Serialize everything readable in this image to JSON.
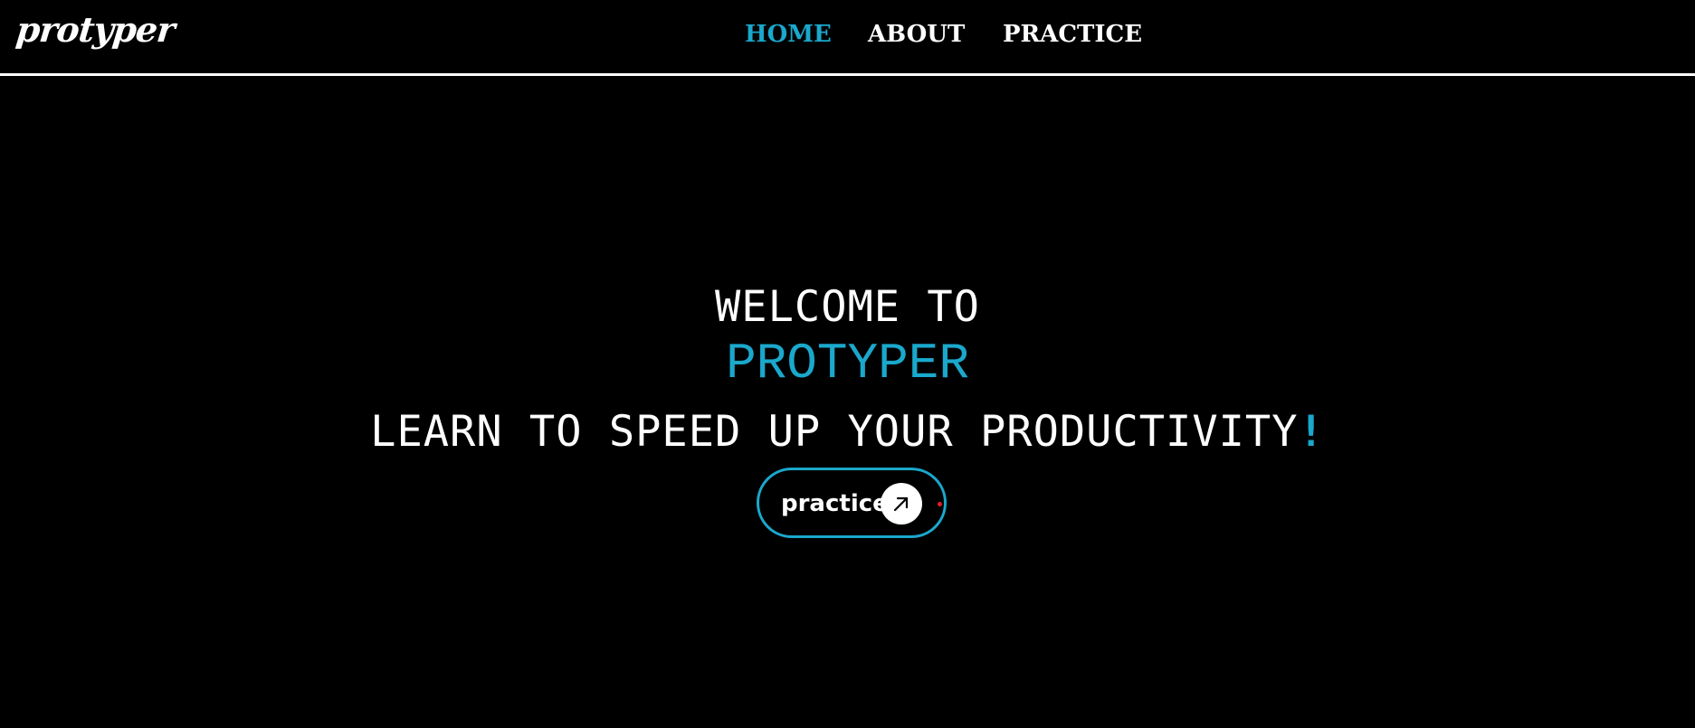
{
  "brand": {
    "logo_text": "protyper"
  },
  "nav": {
    "items": [
      {
        "label": "HOME",
        "active": true
      },
      {
        "label": "ABOUT",
        "active": false
      },
      {
        "label": "PRACTICE",
        "active": false
      }
    ]
  },
  "hero": {
    "welcome": "WELCOME TO",
    "brand_name": "PROTYPER",
    "tagline": "LEARN TO SPEED UP YOUR PRODUCTIVITY",
    "tagline_accent": "!",
    "cta": {
      "label": "practice",
      "icon": "arrow-up-right-icon"
    }
  },
  "colors": {
    "background": "#000000",
    "text": "#ffffff",
    "accent": "#1aa8cc",
    "indicator": "#e02020"
  }
}
